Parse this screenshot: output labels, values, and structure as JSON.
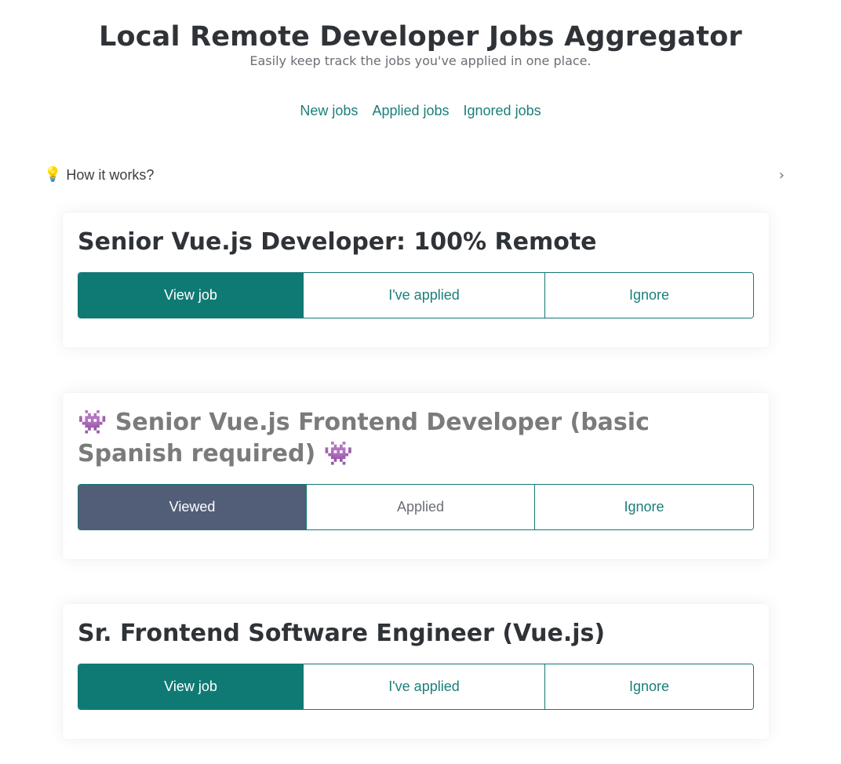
{
  "header": {
    "title": "Local Remote Developer Jobs Aggregator",
    "subtitle": "Easily keep track the jobs you've applied in one place."
  },
  "nav": {
    "new_jobs": "New jobs",
    "applied_jobs": "Applied jobs",
    "ignored_jobs": "Ignored jobs"
  },
  "how_it_works": {
    "icon": "lightbulb-icon",
    "glyph": "💡",
    "label": "How it works?",
    "chevron": "›"
  },
  "jobs": [
    {
      "title": "Senior Vue.js Developer: 100% Remote",
      "view_label": "View job",
      "applied_label": "I've applied",
      "ignore_label": "Ignore"
    },
    {
      "title_prefix_glyph": "👾",
      "title": "Senior Vue.js Frontend Developer (basic Spanish required)",
      "title_suffix_glyph": "👾",
      "view_label": "Viewed",
      "applied_label": "Applied",
      "ignore_label": "Ignore"
    },
    {
      "title": "Sr. Frontend Software Engineer (Vue.js)",
      "view_label": "View job",
      "applied_label": "I've applied",
      "ignore_label": "Ignore"
    }
  ],
  "colors": {
    "accent": "#0f7a74",
    "viewed": "#525e78",
    "text": "#2f3338",
    "muted": "#7b7b7b"
  }
}
